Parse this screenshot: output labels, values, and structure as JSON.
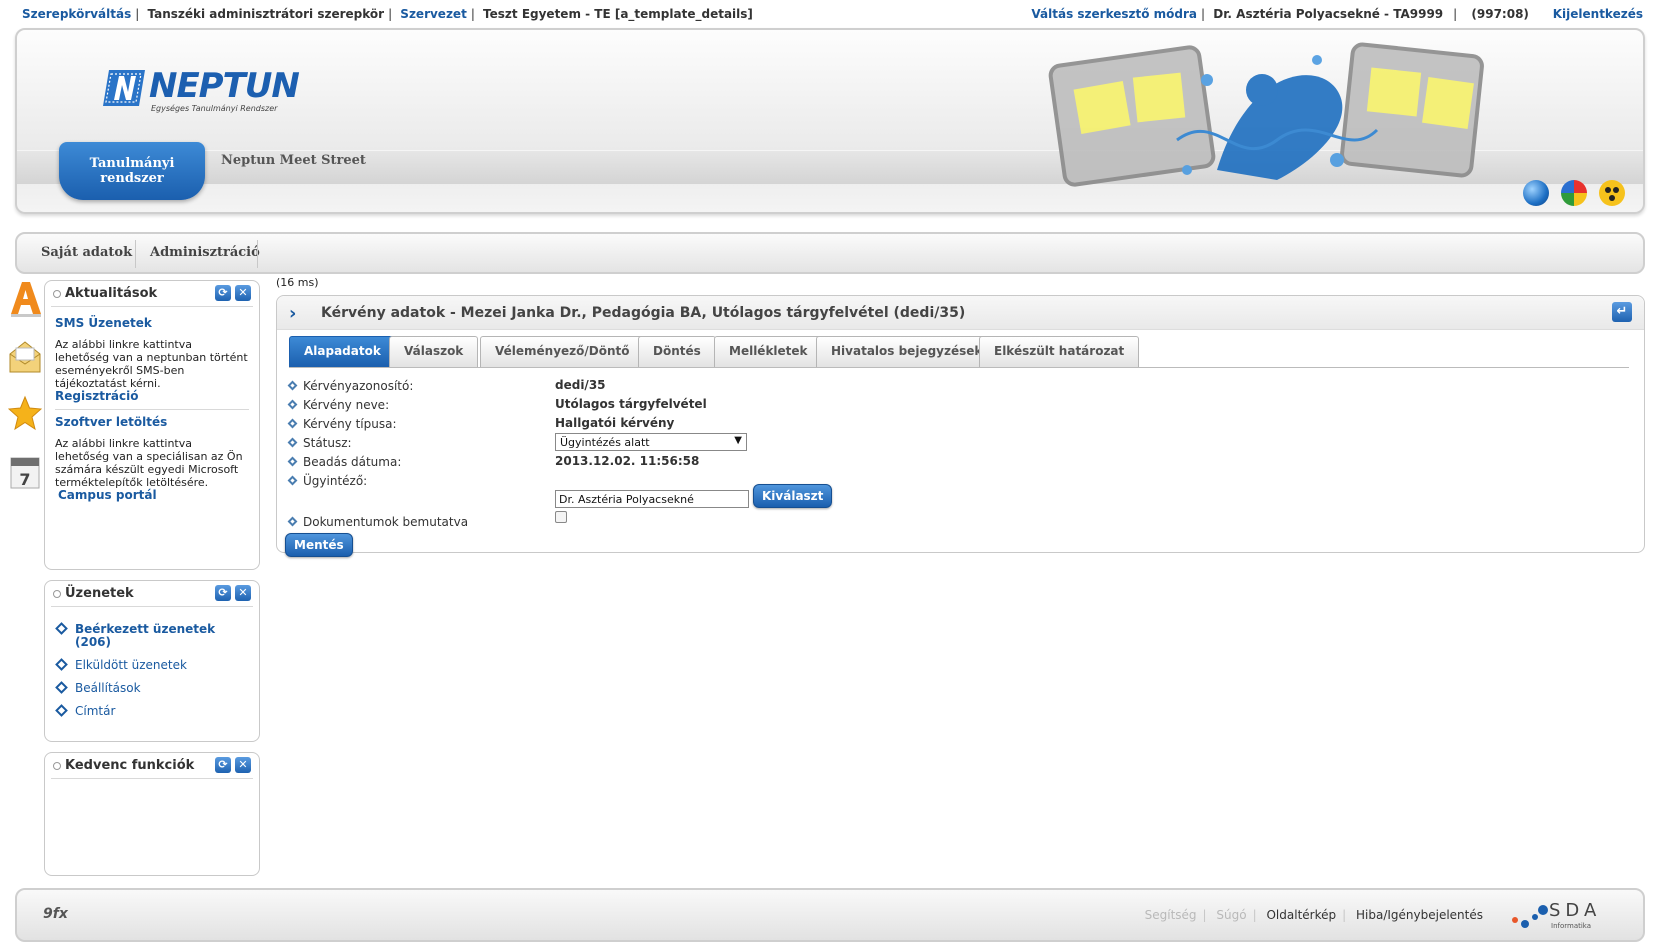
{
  "topbar": {
    "role_switch": "Szerepkörváltás",
    "role": "Tanszéki adminisztrátori szerepkör",
    "org": "Szervezet",
    "institution": "Teszt Egyetem - TE [a_template_details]",
    "edit_mode": "Váltás szerkesztő módra",
    "user": "Dr. Asztéria Polyacsekné - TA9999",
    "session": "(997:08)",
    "logout": "Kijelentkezés"
  },
  "header": {
    "logo_word": "NEPTUN",
    "logo_sub": "Egységes Tanulmányi Rendszer",
    "tab_active": "Tanulmányi rendszer",
    "tab_other": "Neptun Meet Street",
    "icons": [
      "globe-icon",
      "color-palette-icon",
      "accessibility-icon"
    ]
  },
  "menu": {
    "items": [
      "Saját adatok",
      "Adminisztráció"
    ]
  },
  "quick_icons": [
    "font-size-icon",
    "envelope-icon",
    "star-icon",
    "calendar-icon"
  ],
  "calendar_day": "7",
  "sidebar": {
    "news": {
      "title": "Aktualitások",
      "sms_title": "SMS Üzenetek",
      "sms_text": "Az alábbi linkre kattintva lehetőség van a neptunban történt eseményekről SMS-ben tájékoztatást kérni.",
      "sms_link": "Regisztráció",
      "sw_title": "Szoftver letöltés",
      "sw_text": "Az alábbi linkre kattintva lehetőség van a speciálisan az Ön számára készült egyedi Microsoft terméktelepítők letöltésére.",
      "sw_link": "Campus portál"
    },
    "messages": {
      "title": "Üzenetek",
      "items": [
        "Beérkezett üzenetek (206)",
        "Elküldött üzenetek",
        "Beállítások",
        "Címtár"
      ]
    },
    "favorites": {
      "title": "Kedvenc funkciók"
    }
  },
  "main": {
    "timing": "(16 ms)",
    "title": "Kérvény adatok - Mezei Janka Dr., Pedagógia BA, Utólagos tárgyfelvétel (dedi/35)",
    "tabs": [
      "Alapadatok",
      "Válaszok",
      "Véleményező/Döntő",
      "Döntés",
      "Mellékletek",
      "Hivatalos bejegyzések",
      "Elkészült határozat"
    ],
    "active_tab": "Alapadatok",
    "fields": {
      "id_label": "Kérvényazonosító:",
      "id_value": "dedi/35",
      "name_label": "Kérvény neve:",
      "name_value": "Utólagos tárgyfelvétel",
      "type_label": "Kérvény típusa:",
      "type_value": "Hallgatói kérvény",
      "status_label": "Státusz:",
      "status_value": "Ügyintézés alatt",
      "date_label": "Beadás dátuma:",
      "date_value": "2013.12.02. 11:56:58",
      "clerk_label": "Ügyintéző:",
      "clerk_value": "Dr. Asztéria Polyacsekné",
      "select_button": "Kiválaszt",
      "docs_label": "Dokumentumok bemutatva",
      "docs_checked": false
    },
    "save_button": "Mentés"
  },
  "footer": {
    "logo": "9fx",
    "links": {
      "help": "Segítség",
      "manual": "Súgó",
      "sitemap": "Oldaltérkép",
      "bug": "Hiba/Igénybejelentés"
    },
    "brand": "SDA",
    "brand_sub": "Informatika"
  },
  "colors": {
    "accent": "#1b5fae",
    "link": "#1a5aa0"
  }
}
